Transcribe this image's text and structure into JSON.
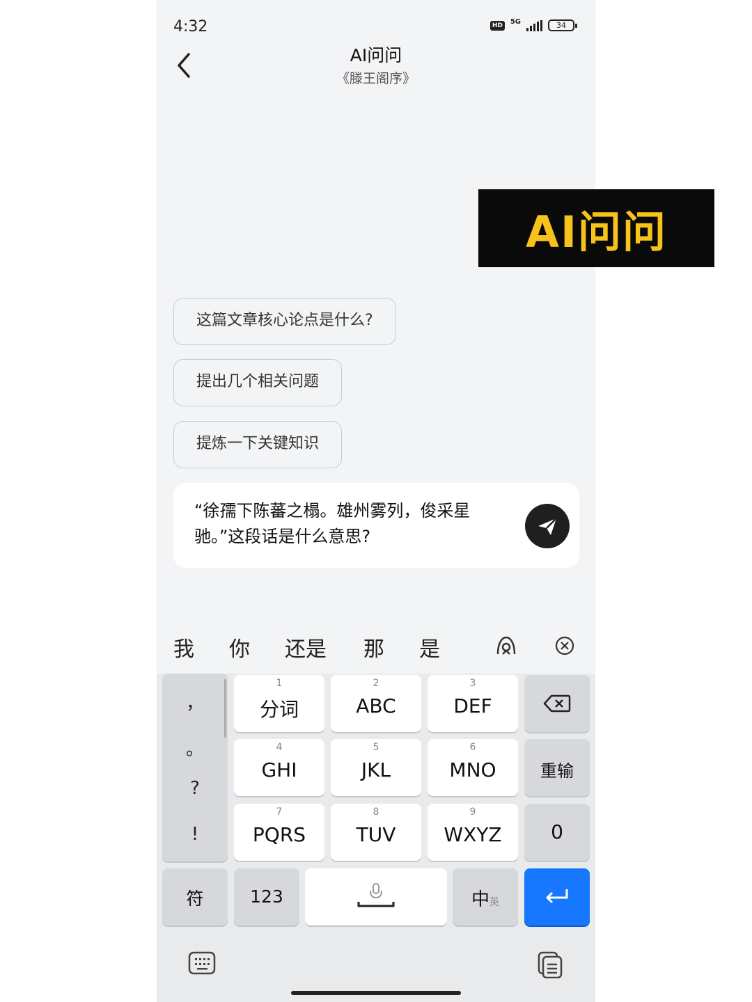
{
  "status": {
    "time": "4:32",
    "hd": "HD",
    "network": "5G",
    "battery": "34"
  },
  "header": {
    "title": "AI问问",
    "subtitle": "《滕王阁序》"
  },
  "suggestions": [
    "这篇文章核心论点是什么?",
    "提出几个相关问题",
    "提炼一下关键知识"
  ],
  "input": {
    "value": "“徐孺下陈蕃之榻。雄州雾列，俊采星驰。”这段话是什么意思?"
  },
  "keyboard": {
    "candidates": [
      "我",
      "你",
      "还是",
      "那",
      "是"
    ],
    "punctuation": [
      "，",
      "。",
      "?",
      "!"
    ],
    "keys": [
      {
        "num": "1",
        "label": "分词"
      },
      {
        "num": "2",
        "label": "ABC"
      },
      {
        "num": "3",
        "label": "DEF"
      },
      {
        "num": "4",
        "label": "GHI"
      },
      {
        "num": "5",
        "label": "JKL"
      },
      {
        "num": "6",
        "label": "MNO"
      },
      {
        "num": "7",
        "label": "PQRS"
      },
      {
        "num": "8",
        "label": "TUV"
      },
      {
        "num": "9",
        "label": "WXYZ"
      }
    ],
    "retype": "重输",
    "zero": "0",
    "symbols": "符",
    "numbers": "123",
    "lang_main": "中",
    "lang_alt": "英",
    "accent": "#1777ff"
  },
  "overlay": {
    "text": "AI问问",
    "color": "#f8c21c"
  }
}
